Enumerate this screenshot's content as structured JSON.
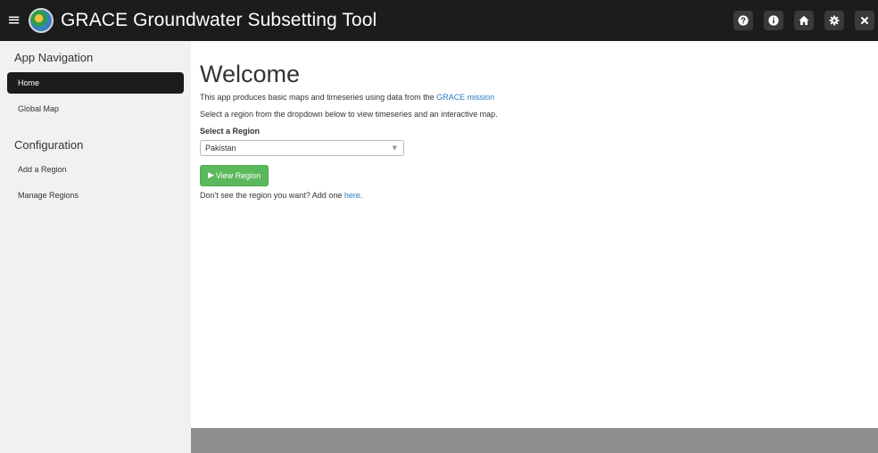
{
  "header": {
    "menu_glyph": "≡",
    "title": "GRACE Groundwater Subsetting Tool",
    "logo_icon": "globe-logo-icon",
    "actions": [
      {
        "name": "help",
        "icon": "question-circle-icon"
      },
      {
        "name": "info",
        "icon": "info-circle-icon"
      },
      {
        "name": "home",
        "icon": "home-icon"
      },
      {
        "name": "settings",
        "icon": "gear-icon"
      },
      {
        "name": "close",
        "icon": "close-icon"
      }
    ]
  },
  "sidebar": {
    "nav_heading": "App Navigation",
    "nav_items": [
      "Home",
      "Global Map"
    ],
    "active_item": "Home",
    "config_heading": "Configuration",
    "config_items": [
      "Add a Region",
      "Manage Regions"
    ]
  },
  "main": {
    "title": "Welcome",
    "intro_text": "This app produces basic maps and timeseries using data from the ",
    "intro_link": "GRACE mission",
    "instruction": "Select a region from the dropdown below to view timeseries and an interactive map.",
    "select_label": "Select a Region",
    "selected_region": "Pakistan",
    "select_caret": "▼",
    "button_label": "View Region",
    "button_icon": "▶",
    "add_text": "Don't see the region you want? Add one ",
    "add_link": "here",
    "add_suffix": "."
  },
  "colors": {
    "header_bg": "#1c1c1c",
    "sidebar_bg": "#f1f1f1",
    "link": "#2a7bc0",
    "button_green": "#5cb85c",
    "footer_bg": "#8e8e8e"
  }
}
